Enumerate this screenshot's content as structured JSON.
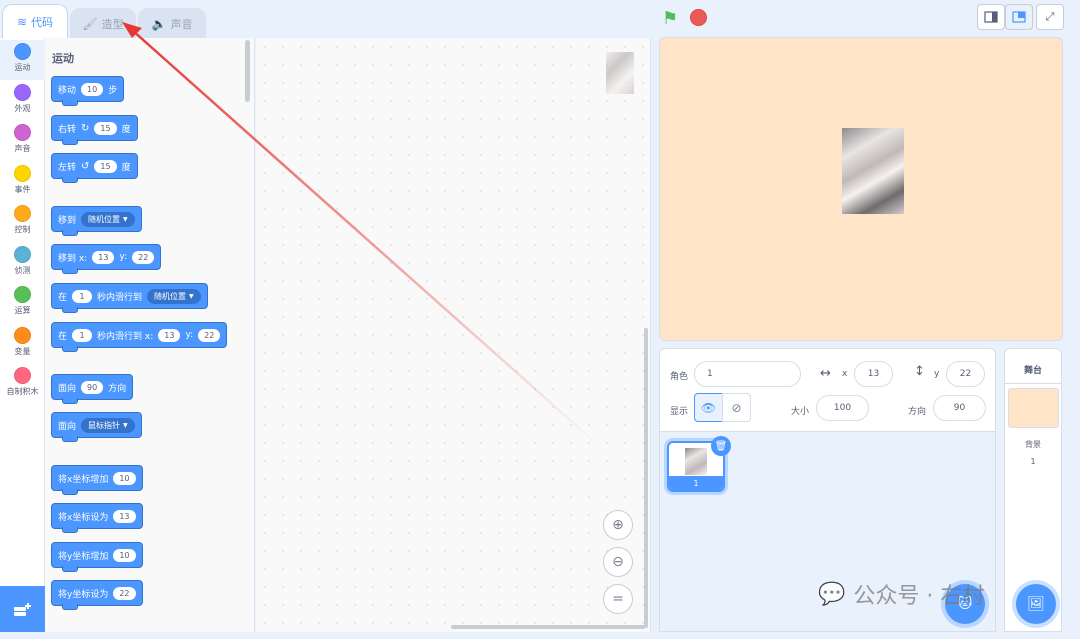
{
  "tabs": [
    {
      "label": "代码",
      "icon": "code-icon",
      "active": true
    },
    {
      "label": "造型",
      "icon": "brush-icon",
      "active": false
    },
    {
      "label": "声音",
      "icon": "speaker-icon",
      "active": false
    }
  ],
  "categories": [
    {
      "label": "运动",
      "color": "#4c97ff"
    },
    {
      "label": "外观",
      "color": "#9966ff"
    },
    {
      "label": "声音",
      "color": "#cf63cf"
    },
    {
      "label": "事件",
      "color": "#ffd500"
    },
    {
      "label": "控制",
      "color": "#ffab19"
    },
    {
      "label": "侦测",
      "color": "#5cb1d6"
    },
    {
      "label": "运算",
      "color": "#59c059"
    },
    {
      "label": "变量",
      "color": "#ff8c1a"
    },
    {
      "label": "自制积木",
      "color": "#ff6680"
    }
  ],
  "palette": {
    "section_title": "运动",
    "blocks": {
      "move": {
        "t1": "移动",
        "v1": "10",
        "t2": "步"
      },
      "turn_right": {
        "t1": "右转",
        "v1": "15",
        "t2": "度"
      },
      "turn_left": {
        "t1": "左转",
        "v1": "15",
        "t2": "度"
      },
      "goto": {
        "t1": "移到",
        "d1": "随机位置"
      },
      "goto_xy": {
        "t1": "移到 x:",
        "v1": "13",
        "t2": "y:",
        "v2": "22"
      },
      "glide": {
        "t1": "在",
        "v1": "1",
        "t2": "秒内滑行到",
        "d1": "随机位置"
      },
      "glide_xy": {
        "t1": "在",
        "v1": "1",
        "t2": "秒内滑行到 x:",
        "v2": "13",
        "t3": "y:",
        "v3": "22"
      },
      "point_dir": {
        "t1": "面向",
        "v1": "90",
        "t2": "方向"
      },
      "point_toward": {
        "t1": "面向",
        "d1": "鼠标指针"
      },
      "change_x": {
        "t1": "将x坐标增加",
        "v1": "10"
      },
      "set_x": {
        "t1": "将x坐标设为",
        "v1": "13"
      },
      "change_y": {
        "t1": "将y坐标增加",
        "v1": "10"
      },
      "set_y": {
        "t1": "将y坐标设为",
        "v1": "22"
      }
    }
  },
  "zoom_buttons": {
    "zoom_in": "⊕",
    "zoom_out": "⊖",
    "reset": "="
  },
  "sprite_info": {
    "sprite_label": "角色",
    "sprite_name": "1",
    "x_label": "x",
    "x_value": "13",
    "y_label": "y",
    "y_value": "22",
    "show_label": "显示",
    "size_label": "大小",
    "size_value": "100",
    "direction_label": "方向",
    "direction_value": "90"
  },
  "sprite_list": {
    "sprite_name": "1"
  },
  "stage_panel": {
    "title": "舞台",
    "backdrop_label": "背景",
    "backdrop_count": "1"
  },
  "colors": {
    "accent": "#4c97ff",
    "stage_bg": "#ffe4c8",
    "annotation_arrow": "#e53935"
  },
  "watermark": {
    "text": "公众号 · 右村"
  }
}
